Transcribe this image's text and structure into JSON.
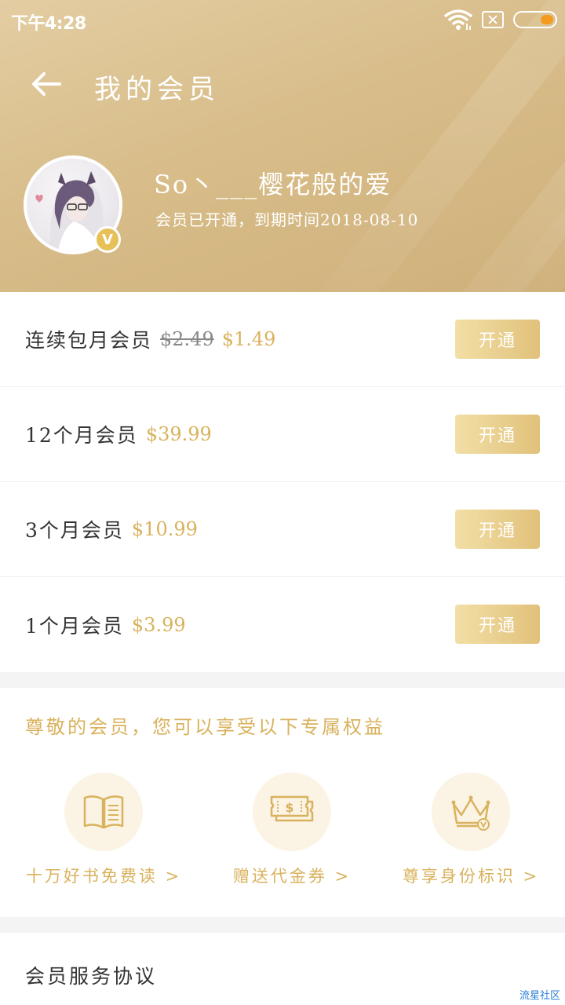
{
  "statusbar": {
    "time": "下午4:28"
  },
  "header": {
    "title": "我的会员",
    "username": "So丶___樱花般的爱",
    "member_status": "会员已开通，到期时间2018-08-10",
    "vip_badge": "V"
  },
  "plans": [
    {
      "name": "连续包月会员",
      "old_price": "$2.49",
      "price": "$1.49",
      "button": "开通"
    },
    {
      "name": "12个月会员",
      "price": "$39.99",
      "button": "开通"
    },
    {
      "name": "3个月会员",
      "price": "$10.99",
      "button": "开通"
    },
    {
      "name": "1个月会员",
      "price": "$3.99",
      "button": "开通"
    }
  ],
  "benefits": {
    "title": "尊敬的会员，您可以享受以下专属权益",
    "items": [
      {
        "label": "十万好书免费读 >",
        "icon": "book-icon"
      },
      {
        "label": "赠送代金券 >",
        "icon": "voucher-icon"
      },
      {
        "label": "尊享身份标识 >",
        "icon": "crown-icon"
      }
    ]
  },
  "agreement": {
    "label": "会员服务协议"
  },
  "watermark": "流星社区",
  "colors": {
    "gold": "#d9b25d",
    "orange_battery": "#f29b1f"
  }
}
